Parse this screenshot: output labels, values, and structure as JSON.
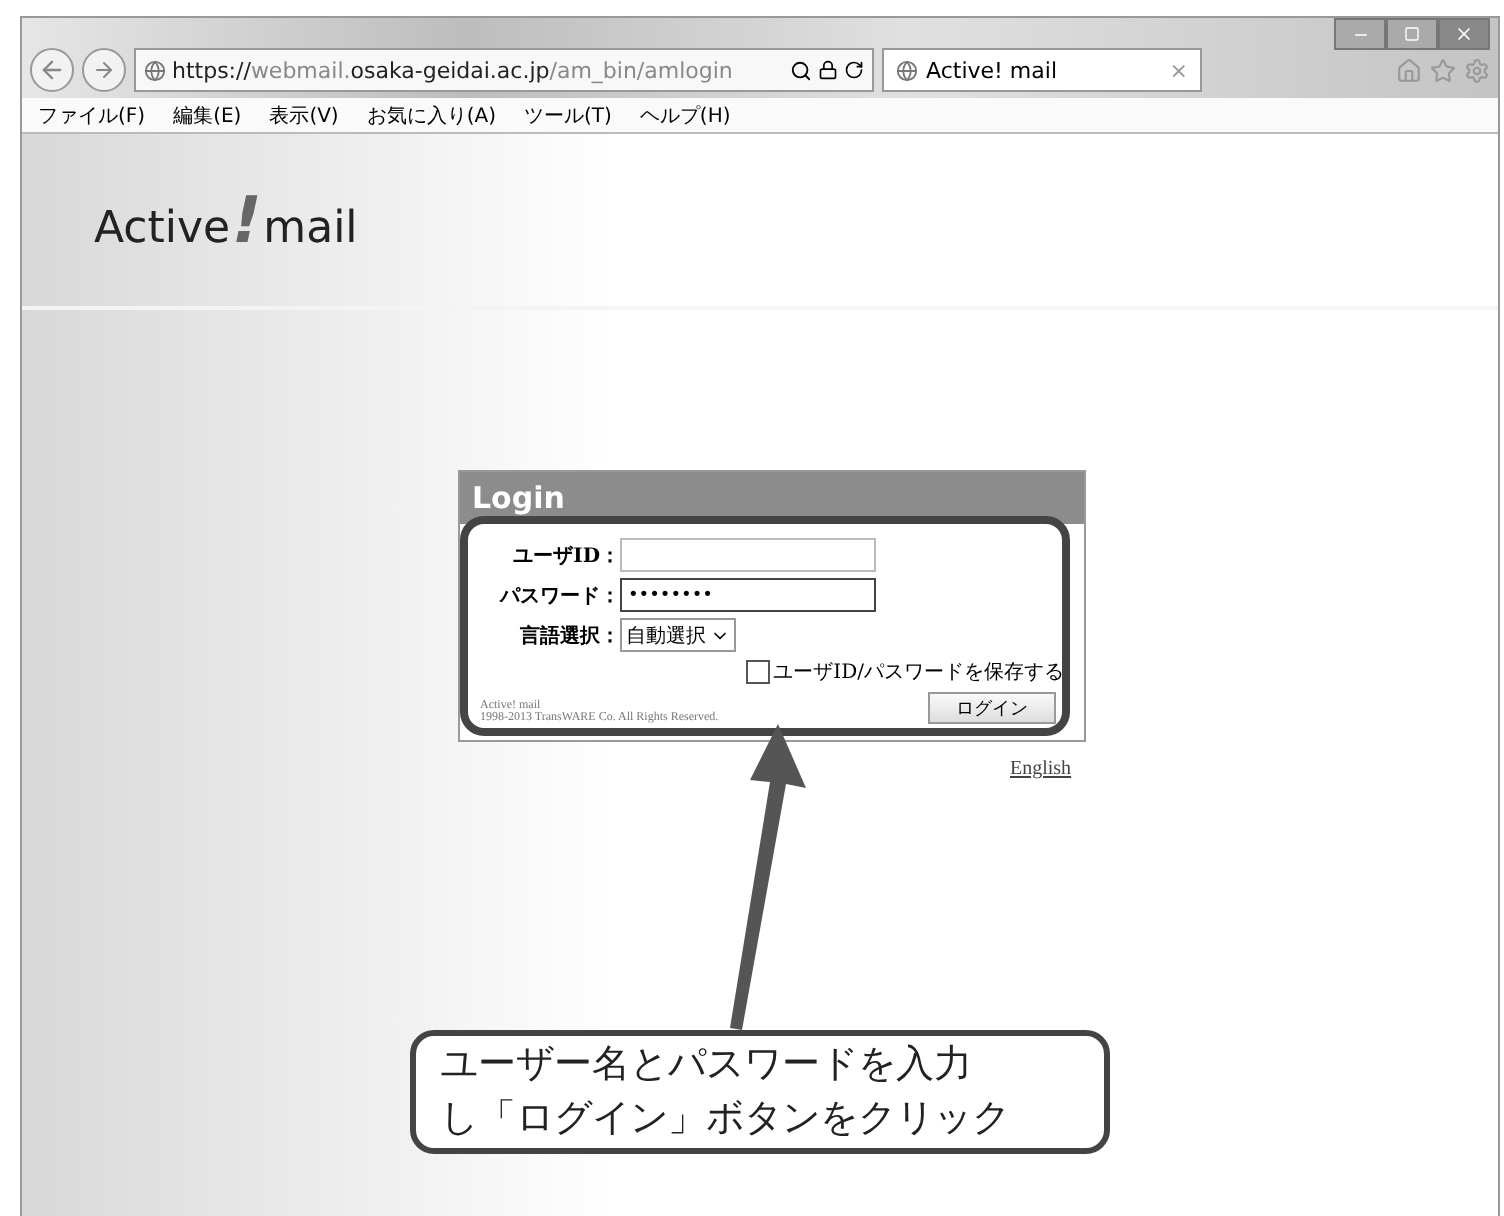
{
  "browser": {
    "url_scheme": "https://",
    "url_host_pre": "webmail.",
    "url_host": "osaka-geidai.ac.jp",
    "url_path": "/am_bin/amlogin",
    "tab_title": "Active! mail",
    "tab_close": "×"
  },
  "menu": [
    "ファイル(F)",
    "編集(E)",
    "表示(V)",
    "お気に入り(A)",
    "ツール(T)",
    "ヘルプ(H)"
  ],
  "logo": {
    "left": "Active",
    "mark": "!",
    "right": "mail"
  },
  "login": {
    "title": "Login",
    "fields": [
      {
        "kind": "text",
        "label": "ユーザID："
      },
      {
        "kind": "password",
        "label": "パスワード：",
        "value": "••••••••"
      },
      {
        "kind": "select",
        "label": "言語選択：",
        "value": "自動選択"
      }
    ],
    "save": {
      "label": "ユーザID/パスワードを保存する",
      "checked": false
    },
    "footer": [
      "Active! mail",
      "1998-2013 TransWARE Co. All Rights Reserved."
    ],
    "button": "ログイン"
  },
  "language_link": "English",
  "callout": [
    "ユーザー名とパスワードを入力",
    "し「ログイン」ボタンをクリック"
  ]
}
